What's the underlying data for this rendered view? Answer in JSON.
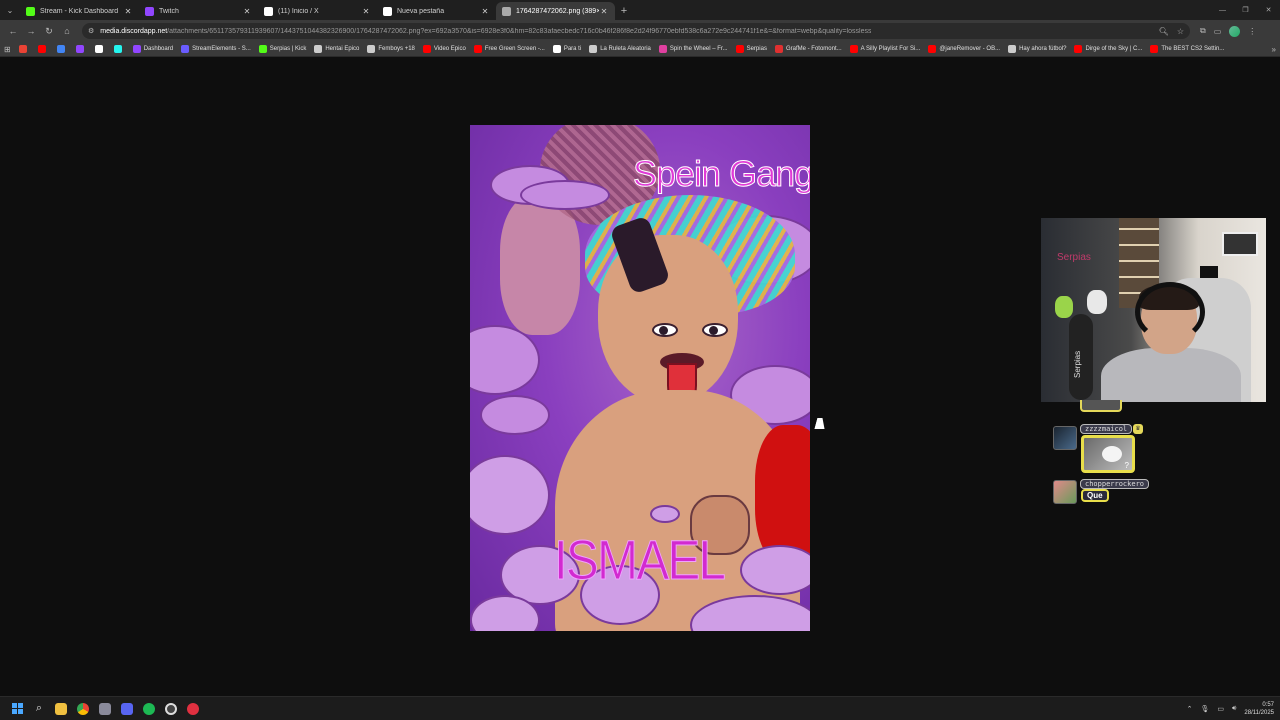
{
  "browser": {
    "tabs": [
      {
        "title": "Stream - Kick Dashboard",
        "favicon": "kick-icon",
        "color": "#53fc18",
        "active": false
      },
      {
        "title": "Twitch",
        "favicon": "twitch-icon",
        "color": "#9146ff",
        "active": false
      },
      {
        "title": "(11) Inicio / X",
        "favicon": "x-icon",
        "color": "#ffffff",
        "active": false
      },
      {
        "title": "Nueva pestaña",
        "favicon": "chrome-icon",
        "color": "#ffffff",
        "active": false
      },
      {
        "title": "1764287472062.png (389×578)",
        "favicon": "image-icon",
        "color": "#aaaaaa",
        "active": true
      }
    ],
    "url_host": "media.discordapp.net",
    "url_path": "/attachments/651173579311939607/1443751044382326900/1764287472062.png?ex=692a3570&is=6928e3f0&hm=82c83afaecbedc716c0b46f286f8e2d24f96770ebfd538c6a272e9c244741f1e&=&format=webp&quality=lossless",
    "bookmarks": [
      {
        "label": "",
        "icon": "gmail-icon",
        "color": "#ea4335"
      },
      {
        "label": "",
        "icon": "youtube-icon",
        "color": "#ff0000"
      },
      {
        "label": "",
        "icon": "drive-icon",
        "color": "#4285f4"
      },
      {
        "label": "",
        "icon": "twitch-icon",
        "color": "#9146ff"
      },
      {
        "label": "",
        "icon": "x-icon",
        "color": "#ffffff"
      },
      {
        "label": "",
        "icon": "tiktok-icon",
        "color": "#25f4ee"
      },
      {
        "label": "Dashboard",
        "icon": "twitch-icon",
        "color": "#9146ff"
      },
      {
        "label": "StreamElements - S...",
        "icon": "streamelements-icon",
        "color": "#6a5cff"
      },
      {
        "label": "Serpias | Kick",
        "icon": "kick-icon",
        "color": "#53fc18"
      },
      {
        "label": "Hentai Epico",
        "icon": "folder-icon",
        "color": "#cccccc"
      },
      {
        "label": "Femboys +18",
        "icon": "folder-icon",
        "color": "#cccccc"
      },
      {
        "label": "Video Epico",
        "icon": "youtube-icon",
        "color": "#ff0000"
      },
      {
        "label": "Free Green Screen -...",
        "icon": "youtube-icon",
        "color": "#ff0000"
      },
      {
        "label": "Para ti",
        "icon": "x-icon",
        "color": "#ffffff"
      },
      {
        "label": "La Ruleta Aleatoria",
        "icon": "wheel-icon",
        "color": "#cccccc"
      },
      {
        "label": "Spin the Wheel – Fr...",
        "icon": "wheel-icon",
        "color": "#e040a0"
      },
      {
        "label": "Serpias",
        "icon": "youtube-icon",
        "color": "#ff0000"
      },
      {
        "label": "GrafMe - Fotomont...",
        "icon": "grafme-icon",
        "color": "#e03030"
      },
      {
        "label": "A Silly Playlist For Si...",
        "icon": "youtube-icon",
        "color": "#ff0000"
      },
      {
        "label": "@janeRemover - OB...",
        "icon": "youtube-icon",
        "color": "#ff0000"
      },
      {
        "label": "Hay ahora fútbol?",
        "icon": "globe-icon",
        "color": "#cccccc"
      },
      {
        "label": "Dirge of the Sky | C...",
        "icon": "youtube-icon",
        "color": "#ff0000"
      },
      {
        "label": "The BEST CS2 Settin...",
        "icon": "youtube-icon",
        "color": "#ff0000"
      }
    ]
  },
  "image": {
    "top_text": "Spein Gang",
    "bottom_text": "ISMAEL"
  },
  "webcam": {
    "sign_text": "Serpias",
    "vertical_text": "Serpias"
  },
  "chat": {
    "messages": [
      {
        "username": "zzzzmaicol",
        "content_type": "emote",
        "emote_text": "?"
      },
      {
        "username": "chopperrockero",
        "content_type": "text",
        "text": "Que"
      }
    ]
  },
  "taskbar": {
    "apps": [
      "windows-start-icon",
      "search-icon",
      "file-explorer-icon",
      "chrome-icon",
      "app-icon",
      "discord-icon",
      "spotify-icon",
      "obs-icon",
      "app-red-icon"
    ],
    "time": "0:57",
    "date": "28/11/2025"
  }
}
